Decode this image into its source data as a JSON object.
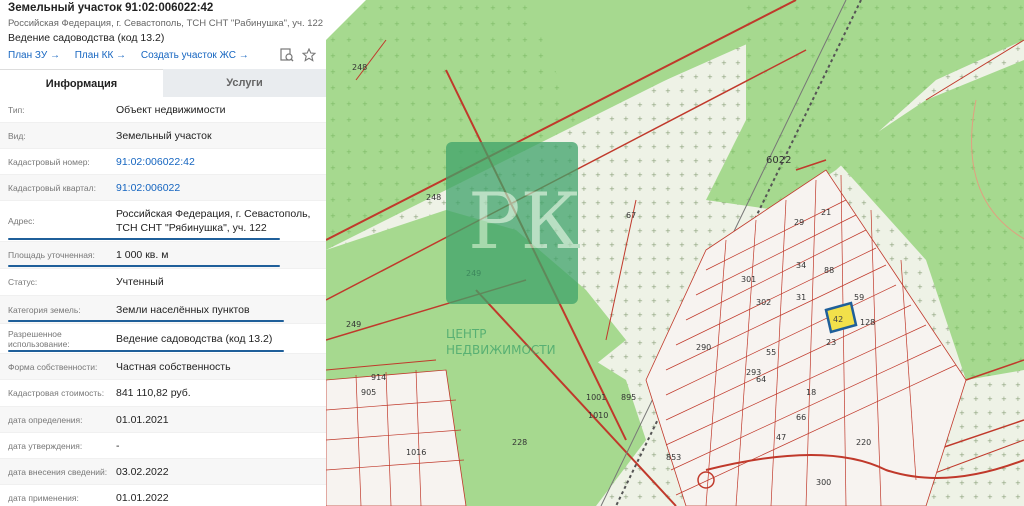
{
  "header": {
    "title": "Земельный участок 91:02:006022:42",
    "address": "Российская Федерация, г. Севастополь, ТСН СНТ \"Рабинушка\", уч. 122",
    "purpose": "Ведение садоводства (код 13.2)",
    "links": [
      "План ЗУ →",
      "План КК →",
      "Создать участок ЖС →"
    ],
    "icons": [
      "search-doc-icon",
      "star-icon"
    ]
  },
  "tabs": [
    {
      "label": "Информация",
      "active": true
    },
    {
      "label": "Услуги",
      "active": false
    }
  ],
  "info": [
    {
      "label": "Тип:",
      "value": "Объект недвижимости"
    },
    {
      "label": "Вид:",
      "value": "Земельный участок"
    },
    {
      "label": "Кадастровый номер:",
      "value": "91:02:006022:42"
    },
    {
      "label": "Кадастровый квартал:",
      "value": "91:02:006022"
    },
    {
      "label": "Адрес:",
      "value": "Российская Федерация, г. Севастополь, ТСН СНТ \"Рябинушка\", уч. 122"
    },
    {
      "label": "Площадь уточненная:",
      "value": "1 000 кв. м"
    },
    {
      "label": "Статус:",
      "value": "Учтенный"
    },
    {
      "label": "Категория земель:",
      "value": "Земли населённых пунктов"
    },
    {
      "label": "Разрешенное использование:",
      "value": "Ведение садоводства (код 13.2)"
    },
    {
      "label": "Форма собственности:",
      "value": "Частная собственность"
    },
    {
      "label": "Кадастровая стоимость:",
      "value": "841 110,82 руб."
    },
    {
      "label": "дата определения:",
      "value": "01.01.2021"
    },
    {
      "label": "дата утверждения:",
      "value": "-"
    },
    {
      "label": "дата внесения сведений:",
      "value": "03.02.2022"
    },
    {
      "label": "дата применения:",
      "value": "01.01.2022"
    }
  ],
  "map": {
    "watermark_text": "ЦЕНТР\nНЕДВИЖИМОСТИ",
    "watermark_letters": "РК",
    "labels": [
      "248",
      "248",
      "249",
      "249",
      "67",
      "228",
      "6022",
      "42",
      "128",
      "21",
      "301",
      "302",
      "29",
      "59",
      "34",
      "55",
      "31",
      "64",
      "47",
      "23",
      "18",
      "66",
      "88",
      "220",
      "290",
      "293",
      "300",
      "905",
      "914",
      "1001",
      "1010",
      "1016",
      "895",
      "853"
    ],
    "colors": {
      "green": "#a6d98f",
      "light": "#eef2e6",
      "red": "#c0392b",
      "selected": "#f2e04a"
    }
  }
}
